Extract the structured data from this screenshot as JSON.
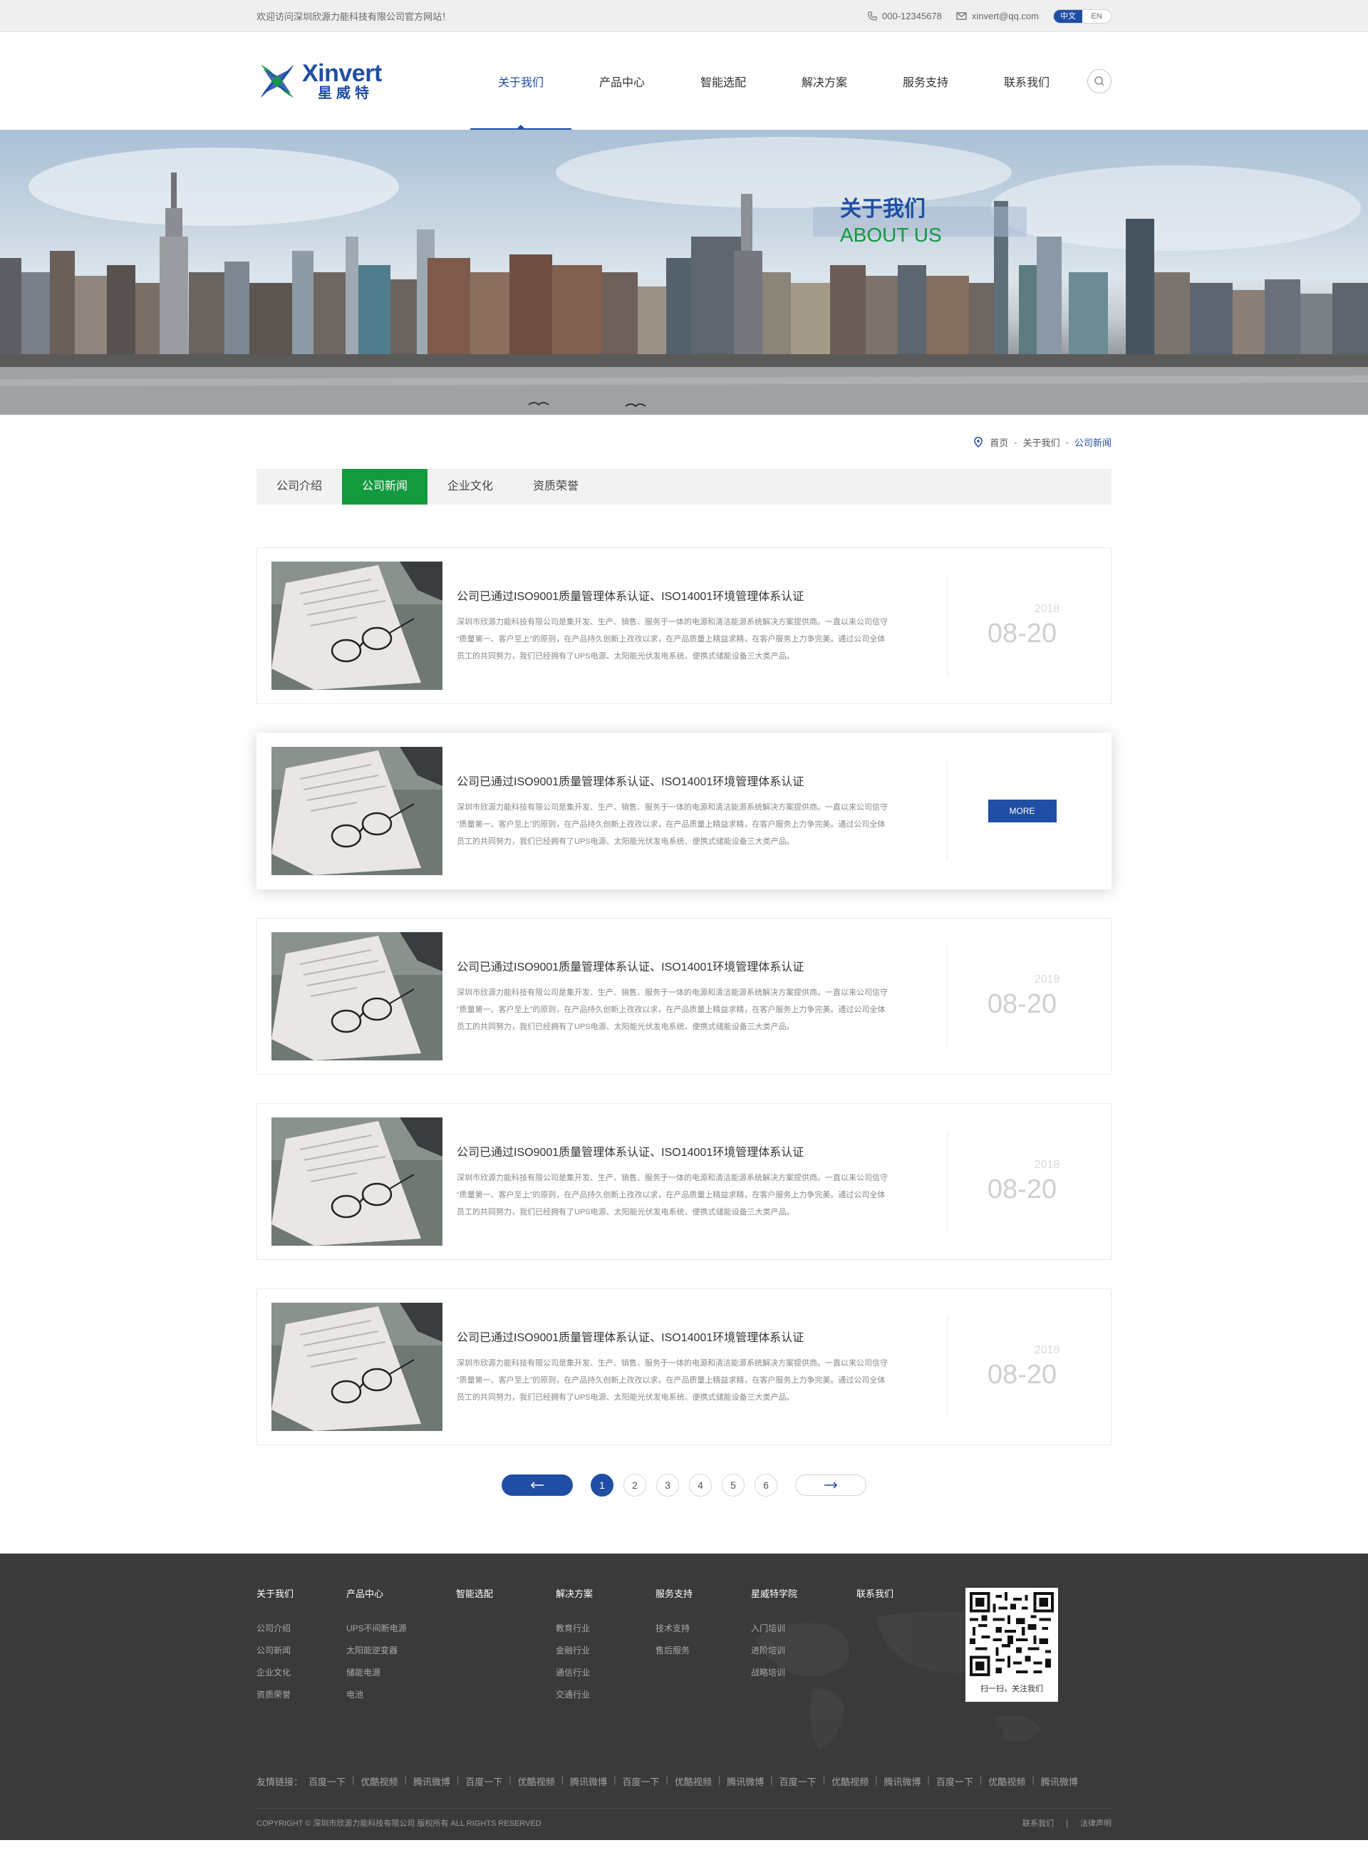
{
  "topbar": {
    "welcome": "欢迎访问深圳欣源力能科技有限公司官方网站！",
    "phone": "000-12345678",
    "email": "xinvert@qq.com",
    "lang_cn": "中文",
    "lang_en": "EN"
  },
  "logo": {
    "en": "Xinvert",
    "cn": "星威特"
  },
  "nav": [
    "关于我们",
    "产品中心",
    "智能选配",
    "解决方案",
    "服务支持",
    "联系我们"
  ],
  "banner": {
    "title_cn": "关于我们",
    "title_en": "ABOUT US"
  },
  "breadcrumb": {
    "home": "首页",
    "parent": "关于我们",
    "current": "公司新闻",
    "sep": "-"
  },
  "tabs": [
    "公司介绍",
    "公司新闻",
    "企业文化",
    "资质荣誉"
  ],
  "news": [
    {
      "title": "公司已通过ISO9001质量管理体系认证、ISO14001环境管理体系认证",
      "desc1": "深圳市欣源力能科技有限公司是集开发、生产、销售、服务于一体的电源和清洁能源系统解决方案提供商。一直以来公司信守",
      "desc2": "“质量第一、客户至上”的原则，在产品持久创新上孜孜以求，在产品质量上精益求精，在客户服务上力争完美。通过公司全体",
      "desc3": "员工的共同努力，我们已经拥有了UPS电源、太阳能光伏发电系统、便携式储能设备三大类产品。",
      "year": "2018",
      "date": "08-20"
    },
    {
      "title": "公司已通过ISO9001质量管理体系认证、ISO14001环境管理体系认证",
      "desc1": "深圳市欣源力能科技有限公司是集开发、生产、销售、服务于一体的电源和清洁能源系统解决方案提供商。一直以来公司信守",
      "desc2": "“质量第一、客户至上”的原则，在产品持久创新上孜孜以求，在产品质量上精益求精，在客户服务上力争完美。通过公司全体",
      "desc3": "员工的共同努力，我们已经拥有了UPS电源、太阳能光伏发电系统、便携式储能设备三大类产品。",
      "more": "MORE"
    },
    {
      "title": "公司已通过ISO9001质量管理体系认证、ISO14001环境管理体系认证",
      "desc1": "深圳市欣源力能科技有限公司是集开发、生产、销售、服务于一体的电源和清洁能源系统解决方案提供商。一直以来公司信守",
      "desc2": "“质量第一、客户至上”的原则，在产品持久创新上孜孜以求，在产品质量上精益求精，在客户服务上力争完美。通过公司全体",
      "desc3": "员工的共同努力，我们已经拥有了UPS电源、太阳能光伏发电系统、便携式储能设备三大类产品。",
      "year": "2018",
      "date": "08-20"
    },
    {
      "title": "公司已通过ISO9001质量管理体系认证、ISO14001环境管理体系认证",
      "desc1": "深圳市欣源力能科技有限公司是集开发、生产、销售、服务于一体的电源和清洁能源系统解决方案提供商。一直以来公司信守",
      "desc2": "“质量第一、客户至上”的原则，在产品持久创新上孜孜以求，在产品质量上精益求精，在客户服务上力争完美。通过公司全体",
      "desc3": "员工的共同努力，我们已经拥有了UPS电源、太阳能光伏发电系统、便携式储能设备三大类产品。",
      "year": "2018",
      "date": "08-20"
    },
    {
      "title": "公司已通过ISO9001质量管理体系认证、ISO14001环境管理体系认证",
      "desc1": "深圳市欣源力能科技有限公司是集开发、生产、销售、服务于一体的电源和清洁能源系统解决方案提供商。一直以来公司信守",
      "desc2": "“质量第一、客户至上”的原则，在产品持久创新上孜孜以求，在产品质量上精益求精，在客户服务上力争完美。通过公司全体",
      "desc3": "员工的共同努力，我们已经拥有了UPS电源、太阳能光伏发电系统、便携式储能设备三大类产品。",
      "year": "2018",
      "date": "08-20"
    }
  ],
  "pager": {
    "pages": [
      "1",
      "2",
      "3",
      "4",
      "5",
      "6"
    ],
    "current": "1"
  },
  "footer": {
    "cols": [
      {
        "h": "关于我们",
        "links": [
          "公司介绍",
          "公司新闻",
          "企业文化",
          "资质荣誉"
        ]
      },
      {
        "h": "产品中心",
        "links": [
          "UPS不间断电源",
          "太阳能逆变器",
          "储能电源",
          "电池"
        ]
      },
      {
        "h": "智能选配",
        "links": []
      },
      {
        "h": "解决方案",
        "links": [
          "教育行业",
          "金融行业",
          "通信行业",
          "交通行业"
        ]
      },
      {
        "h": "服务支持",
        "links": [
          "技术支持",
          "售后服务"
        ]
      },
      {
        "h": "星威特学院",
        "links": [
          "入门培训",
          "进阶培训",
          "战略培训"
        ]
      },
      {
        "h": "联系我们",
        "links": []
      }
    ],
    "qr_caption": "扫一扫，关注我们",
    "friend_label": "友情链接：",
    "friend_links": [
      "百度一下",
      "优酷视频",
      "腾讯微博",
      "百度一下",
      "优酷视频",
      "腾讯微博",
      "百度一下",
      "优酷视频",
      "腾讯微博",
      "百度一下",
      "优酷视频",
      "腾讯微博",
      "百度一下",
      "优酷视频",
      "腾讯微博"
    ],
    "copyright": "COPYRIGHT © 深圳市欣源力能科技有限公司  版权所有  ALL RIGHTS  RESERVED",
    "bottom_links": [
      "联系我们",
      "|",
      "法律声明"
    ]
  },
  "colors": {
    "brand_blue": "#1f4ea4",
    "brand_green": "#139a3f",
    "footer_bg": "#3a3a3a"
  }
}
